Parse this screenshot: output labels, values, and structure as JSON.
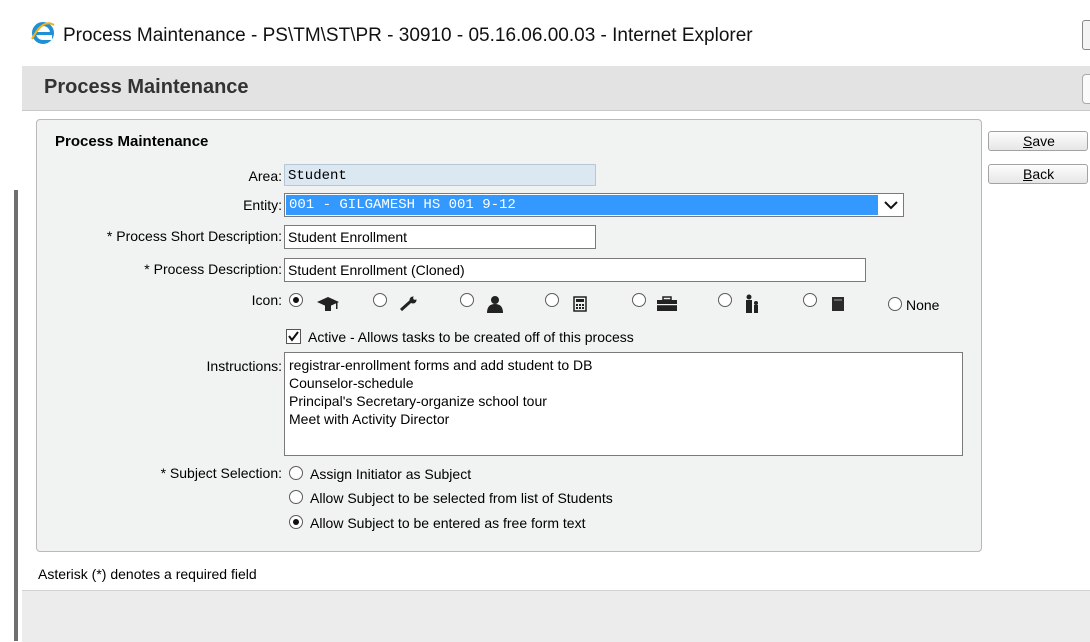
{
  "window": {
    "title": "Process Maintenance - PS\\TM\\ST\\PR - 30910 - 05.16.06.00.03 - Internet Explorer",
    "browser_icon": "internet-explorer-icon"
  },
  "header": {
    "title": "Process Maintenance"
  },
  "form": {
    "section_title": "Process Maintenance",
    "area": {
      "label": "Area:",
      "value": "Student"
    },
    "entity": {
      "label": "Entity:",
      "value": "001 - GILGAMESH HS 001 9-12"
    },
    "short_description": {
      "label": "* Process Short Description:",
      "value": "Student Enrollment"
    },
    "description": {
      "label": "* Process Description:",
      "value": "Student Enrollment (Cloned)"
    },
    "icon": {
      "label": "Icon:",
      "options": [
        {
          "name": "graduation-cap-icon",
          "selected": true
        },
        {
          "name": "wrench-icon",
          "selected": false
        },
        {
          "name": "person-icon",
          "selected": false
        },
        {
          "name": "calculator-icon",
          "selected": false
        },
        {
          "name": "briefcase-icon",
          "selected": false
        },
        {
          "name": "parent-child-icon",
          "selected": false
        },
        {
          "name": "book-icon",
          "selected": false
        }
      ],
      "none_label": "None"
    },
    "active": {
      "checked": true,
      "label": "Active - Allows tasks to be created off of this process"
    },
    "instructions": {
      "label": "Instructions:",
      "lines": [
        "registrar-enrollment forms and add student to DB",
        "Counselor-schedule",
        "Principal's Secretary-organize school tour",
        "Meet with Activity Director"
      ]
    },
    "subject_selection": {
      "label": "* Subject Selection:",
      "options": [
        {
          "label": "Assign Initiator as Subject",
          "selected": false
        },
        {
          "label": "Allow Subject to be selected from list of Students",
          "selected": false
        },
        {
          "label": "Allow Subject to be entered as free form text",
          "selected": true
        }
      ]
    }
  },
  "buttons": {
    "save": {
      "access_key": "S",
      "rest": "ave"
    },
    "back": {
      "access_key": "B",
      "rest": "ack"
    }
  },
  "footnote": "Asterisk (*) denotes a required field",
  "colors": {
    "selection_blue": "#3399ff",
    "readonly_bg": "#dbe7f1",
    "panel_bg": "#f1f2f2"
  }
}
